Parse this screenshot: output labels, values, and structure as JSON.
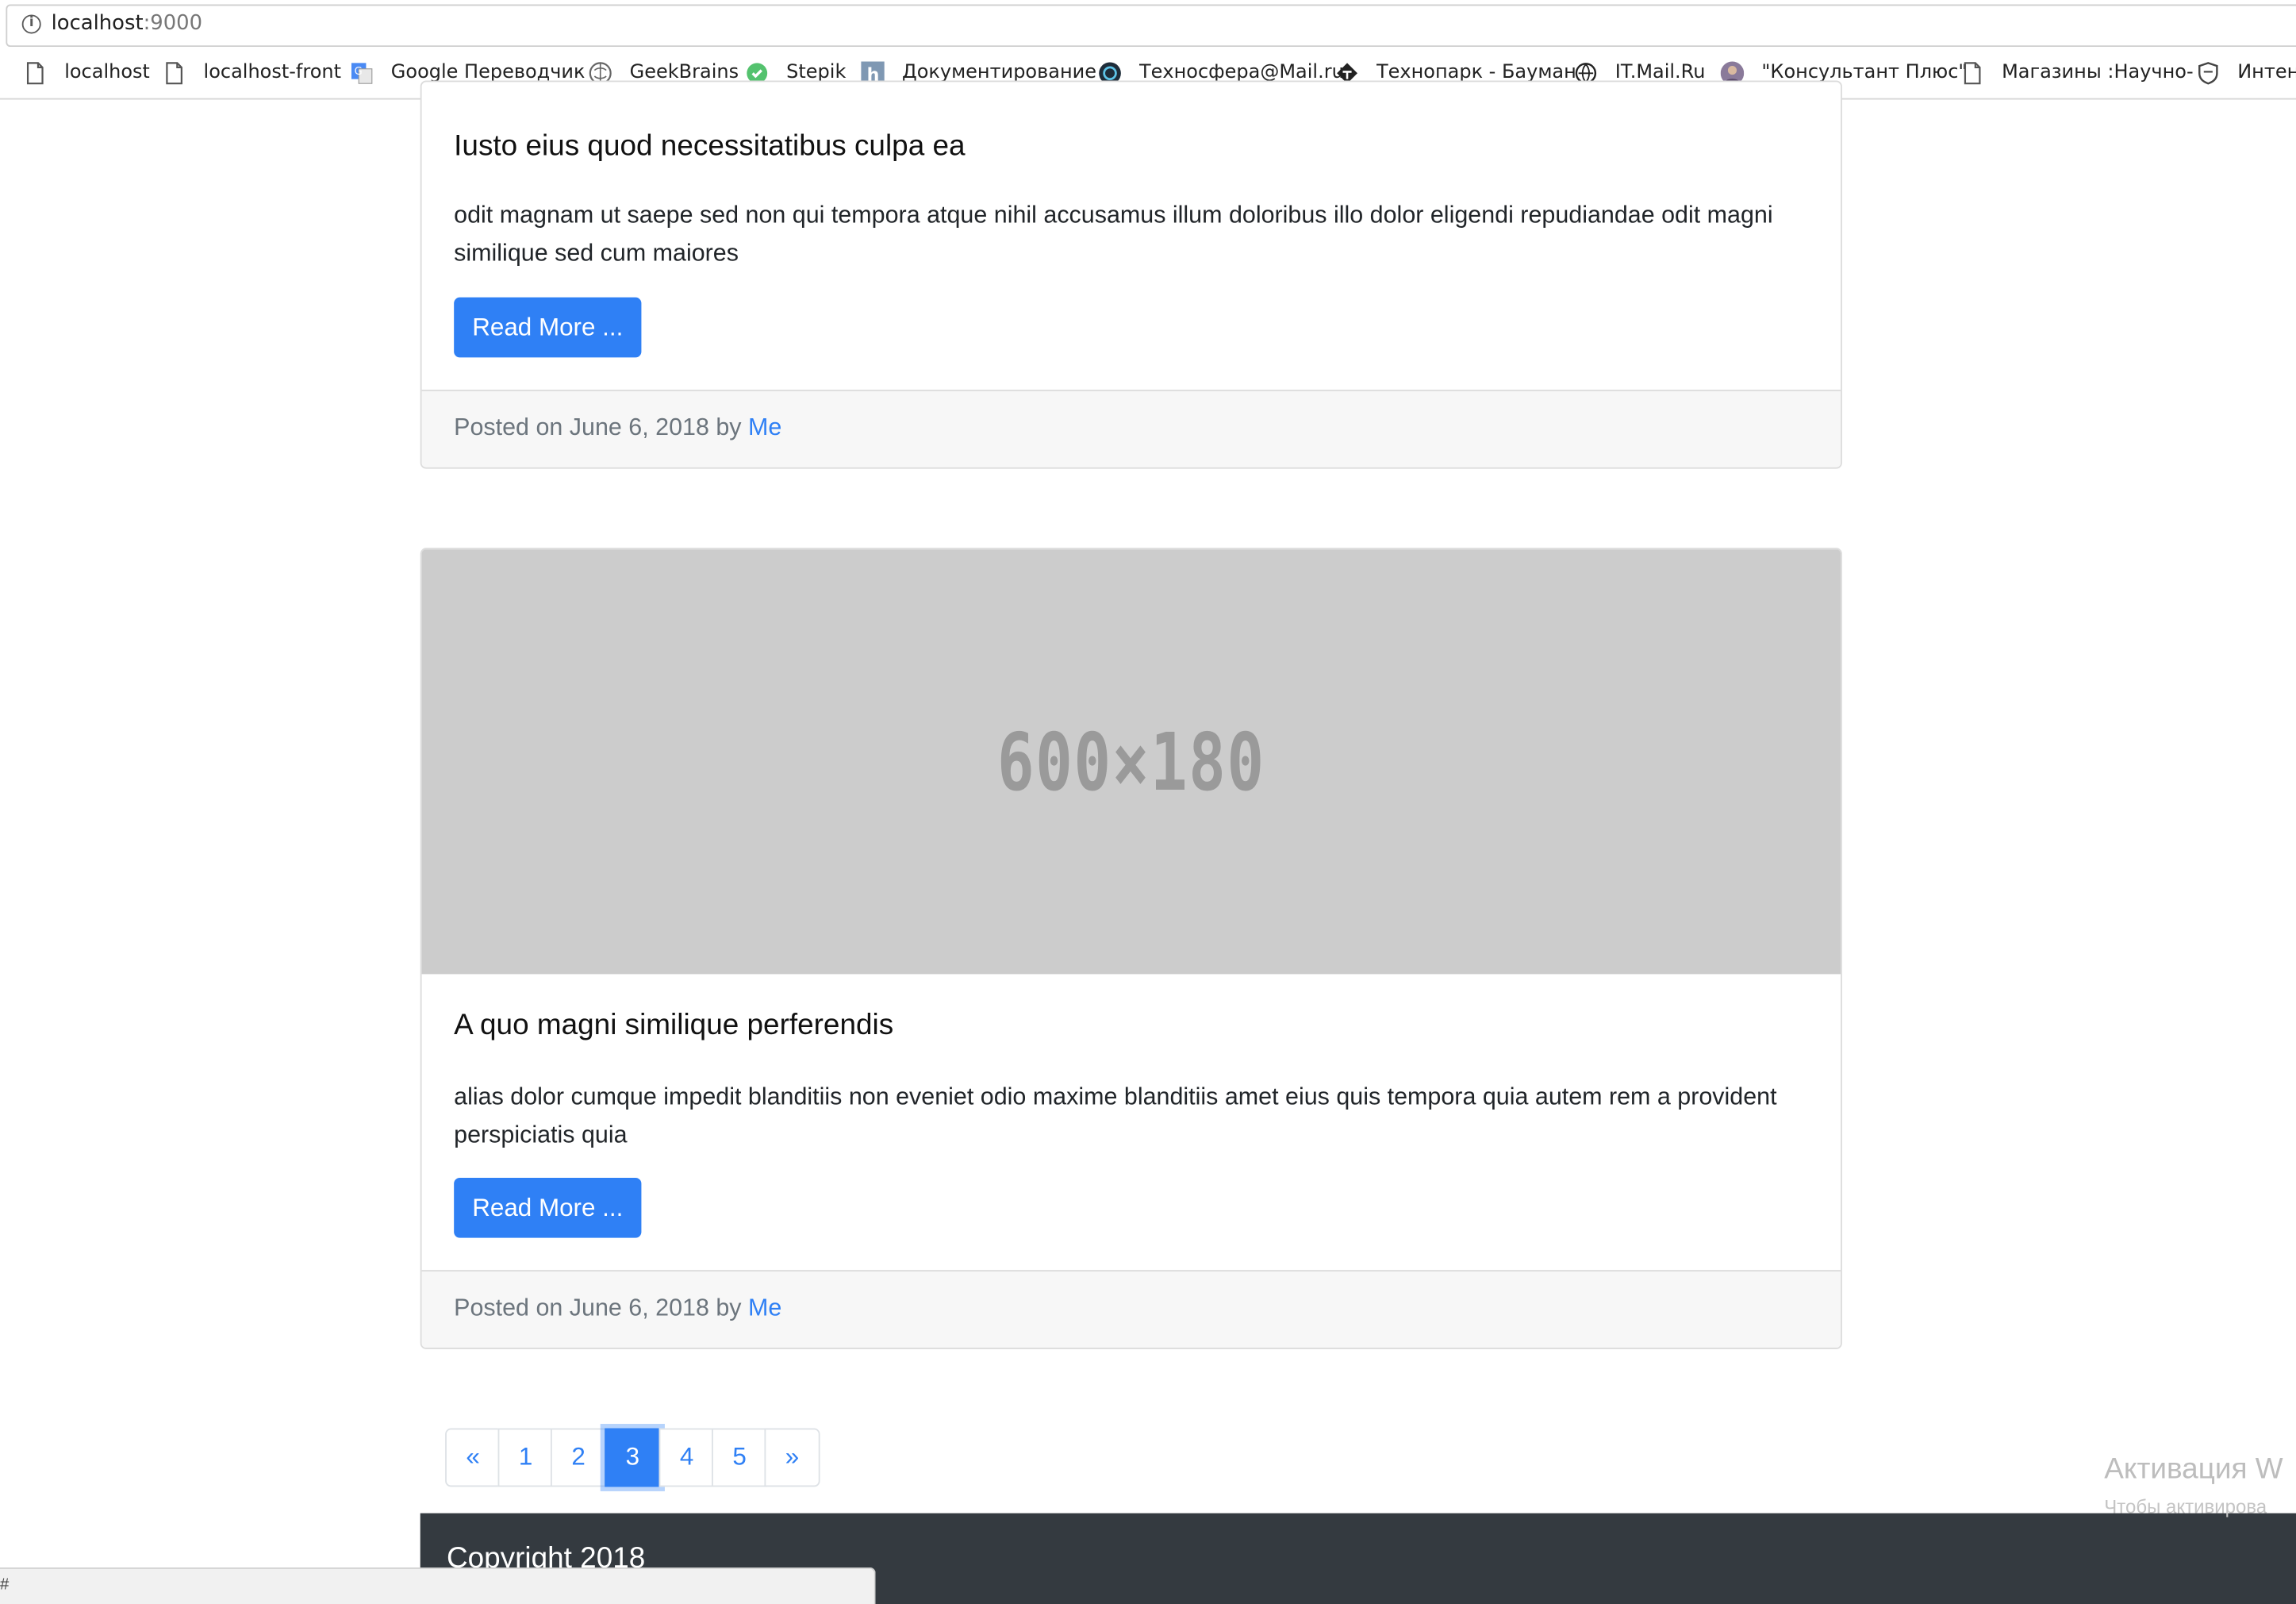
{
  "browser": {
    "url_host": "localhost",
    "url_port": ":9000"
  },
  "bookmarks": [
    {
      "label": "localhost",
      "icon": "page-icon"
    },
    {
      "label": "localhost-front",
      "icon": "page-icon"
    },
    {
      "label": "Google Переводчик",
      "icon": "google-translate-icon"
    },
    {
      "label": "GeekBrains",
      "icon": "geekbrains-icon"
    },
    {
      "label": "Stepik",
      "icon": "stepik-icon"
    },
    {
      "label": "Документирование",
      "icon": "h-icon"
    },
    {
      "label": "Техносфера@Mail.ru",
      "icon": "technosphere-icon"
    },
    {
      "label": "Технопарк - Бауман",
      "icon": "technopark-icon"
    },
    {
      "label": "IT.Mail.Ru",
      "icon": "itmail-icon"
    },
    {
      "label": "\"Консультант Плюс\"",
      "icon": "avatar-icon"
    },
    {
      "label": "Магазины :Научно-",
      "icon": "page-icon"
    },
    {
      "label": "Интен",
      "icon": "shield-icon"
    }
  ],
  "posts": [
    {
      "title": "Iusto eius quod necessitatibus culpa ea",
      "body": "odit magnam ut saepe sed non qui tempora atque nihil accusamus illum doloribus illo dolor eligendi repudiandae odit magni similique sed cum maiores",
      "button": "Read More ...",
      "posted": "Posted on June 6, 2018 by ",
      "author": "Me"
    },
    {
      "image_text": "600×180",
      "title": "A quo magni similique perferendis",
      "body": "alias dolor cumque impedit blanditiis non eveniet odio maxime blanditiis amet eius quis tempora quia autem rem a provident perspiciatis quia",
      "button": "Read More ...",
      "posted": "Posted on June 6, 2018 by ",
      "author": "Me"
    }
  ],
  "pagination": {
    "prev": "«",
    "pages": [
      "1",
      "2",
      "3",
      "4",
      "5"
    ],
    "active": "3",
    "next": "»"
  },
  "footer": {
    "copyright": "Copyright 2018"
  },
  "watermark": {
    "line1": "Активация W",
    "line2": "Чтобы активирова"
  },
  "statusbar": {
    "text": "#"
  },
  "colors": {
    "primary": "#2f80f5",
    "footer_bg": "#343a40",
    "placeholder_bg": "#cccccc"
  }
}
